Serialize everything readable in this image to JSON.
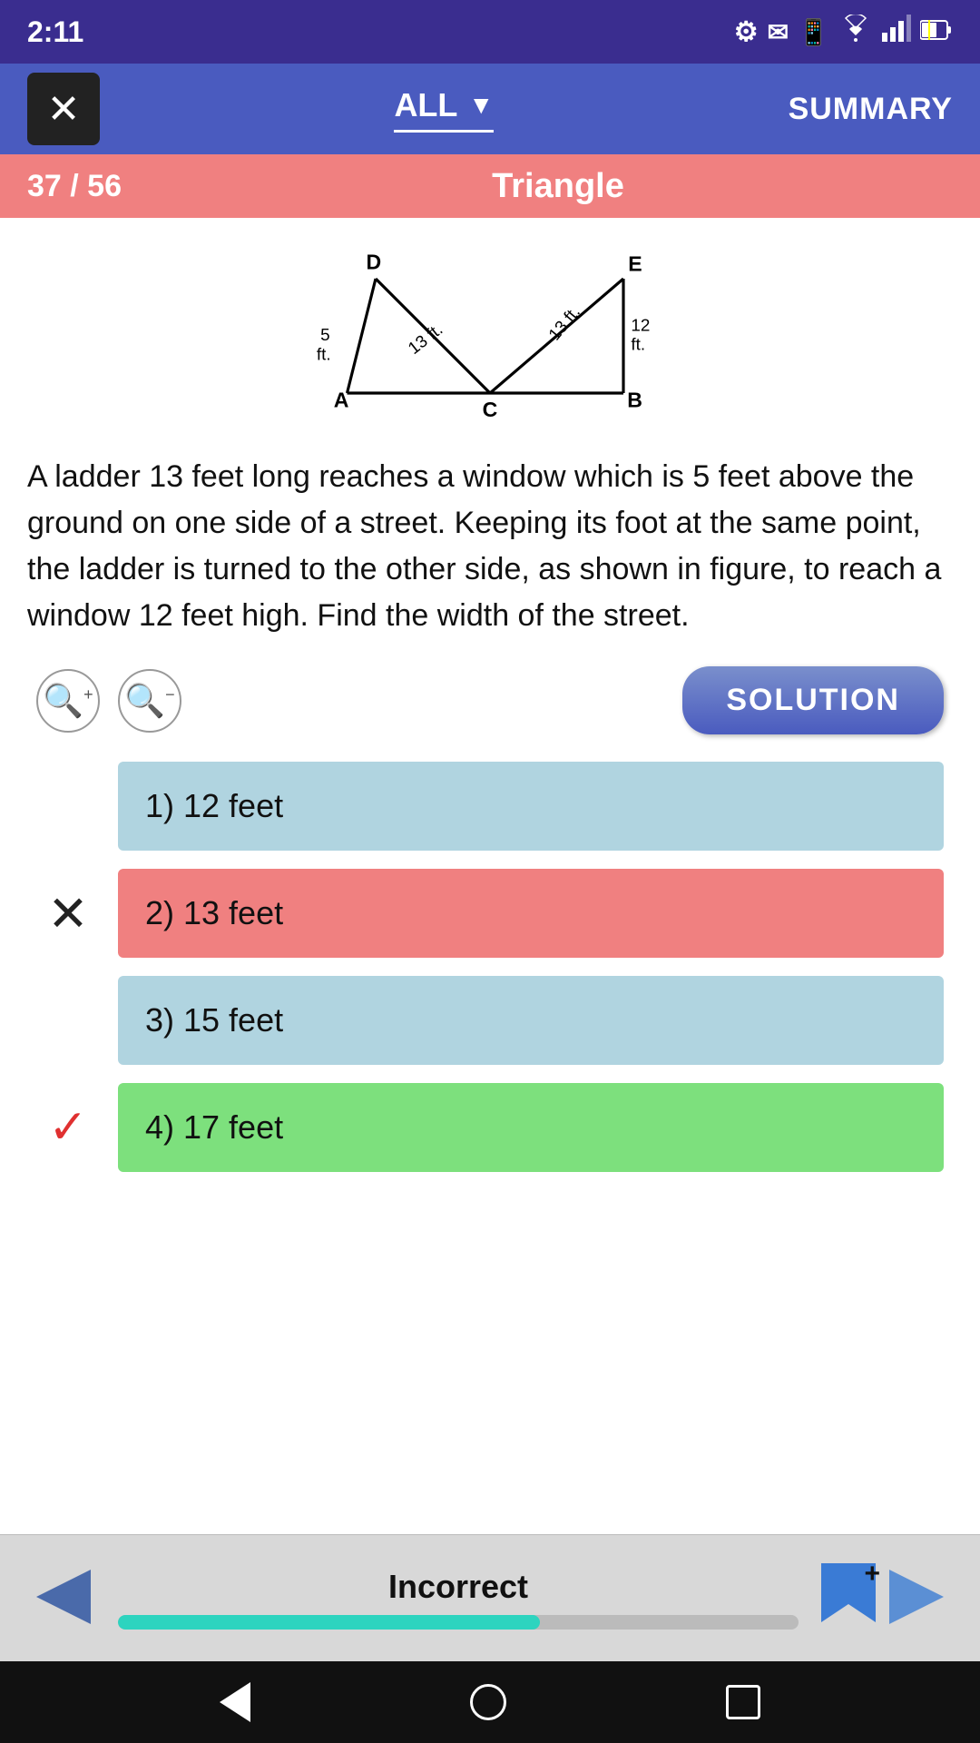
{
  "status_bar": {
    "time": "2:11",
    "icons": [
      "settings",
      "gmail",
      "phone"
    ]
  },
  "nav_bar": {
    "close_label": "✕",
    "filter_label": "ALL",
    "summary_label": "SUMMARY"
  },
  "progress": {
    "count": "37 / 56",
    "title": "Triangle"
  },
  "question": {
    "text": "A ladder 13 feet long reaches a window which is 5 feet above the ground on one side of a street. Keeping its foot at the same point, the ladder is turned to the other side, as shown in figure, to reach a window 12 feet high. Find the width of the street."
  },
  "controls": {
    "zoom_in_label": "+",
    "zoom_out_label": "−",
    "solution_label": "SOLUTION"
  },
  "options": [
    {
      "id": 1,
      "label": "1) 12 feet",
      "style": "blue",
      "indicator": ""
    },
    {
      "id": 2,
      "label": "2) 13 feet",
      "style": "red",
      "indicator": "✕"
    },
    {
      "id": 3,
      "label": "3) 15 feet",
      "style": "blue",
      "indicator": ""
    },
    {
      "id": 4,
      "label": "4) 17 feet",
      "style": "green",
      "indicator": "✓"
    }
  ],
  "bottom": {
    "incorrect_label": "Incorrect",
    "progress_percent": 62
  },
  "diagram": {
    "label_A": "A",
    "label_B": "B",
    "label_C": "C",
    "label_D": "D",
    "label_E": "E",
    "side_5": "5 ft.",
    "side_13_left": "13 ft.",
    "side_13_right": "13 ft.",
    "side_12": "12 ft."
  }
}
